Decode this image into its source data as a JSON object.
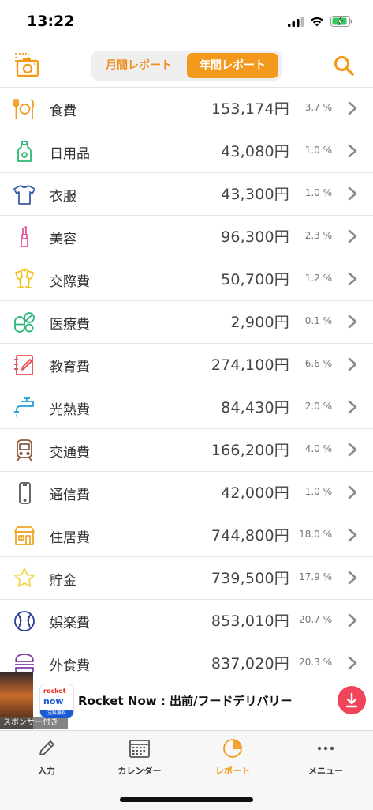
{
  "status_bar": {
    "time": "13:22"
  },
  "header": {
    "segment": {
      "monthly_label": "月間レポート",
      "yearly_label": "年間レポート",
      "selected": "yearly"
    }
  },
  "colors": {
    "accent": "#f39a1c",
    "ad_button": "#f0445a"
  },
  "categories": [
    {
      "label": "食費",
      "amount": "153,174円",
      "percent": "3.7 %",
      "icon": "fork-plate-knife-icon"
    },
    {
      "label": "日用品",
      "amount": "43,080円",
      "percent": "1.0 %",
      "icon": "detergent-bottle-icon"
    },
    {
      "label": "衣服",
      "amount": "43,300円",
      "percent": "1.0 %",
      "icon": "tshirt-icon"
    },
    {
      "label": "美容",
      "amount": "96,300円",
      "percent": "2.3 %",
      "icon": "lipstick-icon"
    },
    {
      "label": "交際費",
      "amount": "50,700円",
      "percent": "1.2 %",
      "icon": "champagne-glasses-icon"
    },
    {
      "label": "医療費",
      "amount": "2,900円",
      "percent": "0.1 %",
      "icon": "pills-icon"
    },
    {
      "label": "教育費",
      "amount": "274,100円",
      "percent": "6.6 %",
      "icon": "notebook-pencil-icon"
    },
    {
      "label": "光熱費",
      "amount": "84,430円",
      "percent": "2.0 %",
      "icon": "faucet-icon"
    },
    {
      "label": "交通費",
      "amount": "166,200円",
      "percent": "4.0 %",
      "icon": "train-icon"
    },
    {
      "label": "通信費",
      "amount": "42,000円",
      "percent": "1.0 %",
      "icon": "smartphone-icon"
    },
    {
      "label": "住居費",
      "amount": "744,800円",
      "percent": "18.0 %",
      "icon": "house-icon"
    },
    {
      "label": "貯金",
      "amount": "739,500円",
      "percent": "17.9 %",
      "icon": "star-icon"
    },
    {
      "label": "娯楽費",
      "amount": "853,010円",
      "percent": "20.7 %",
      "icon": "baseball-icon"
    },
    {
      "label": "外食費",
      "amount": "837,020円",
      "percent": "20.3 %",
      "icon": "burger-icon"
    }
  ],
  "ad": {
    "sponsor_label": "スポンサー付き",
    "logo_top": "rocket",
    "logo_mid": "now",
    "logo_bottom": "送料無料",
    "title": "Rocket Now : 出前/フードデリバリー"
  },
  "tabbar": {
    "tabs": [
      {
        "label": "入力",
        "icon": "pencil-icon"
      },
      {
        "label": "カレンダー",
        "icon": "calendar-icon"
      },
      {
        "label": "レポート",
        "icon": "pie-chart-icon",
        "active": true
      },
      {
        "label": "メニュー",
        "icon": "more-dots-icon"
      }
    ]
  }
}
